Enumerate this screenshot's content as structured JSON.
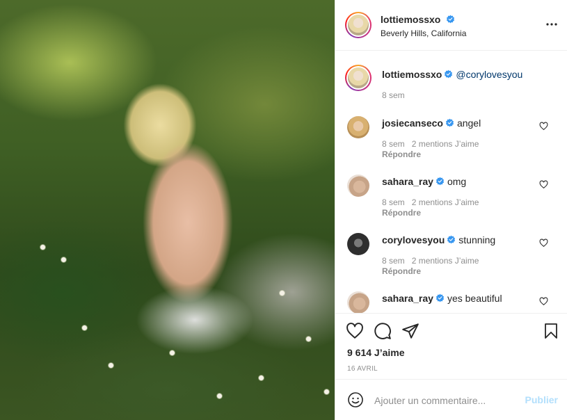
{
  "post": {
    "author": "lottiemossxo",
    "location": "Beverly Hills, California",
    "caption_mention": "@corylovesyou",
    "caption_time": "8 sem",
    "likes": "9 614 J’aime",
    "date": "16 AVRIL"
  },
  "comments": [
    {
      "user": "josiecanseco",
      "text": "angel",
      "time": "8 sem",
      "likes": "2 mentions J’aime",
      "reply": "Répondre"
    },
    {
      "user": "sahara_ray",
      "text": "omg",
      "time": "8 sem",
      "likes": "2 mentions J’aime",
      "reply": "Répondre"
    },
    {
      "user": "corylovesyou",
      "text": "stunning",
      "time": "8 sem",
      "likes": "2 mentions J’aime",
      "reply": "Répondre"
    },
    {
      "user": "sahara_ray",
      "text": "yes beautiful"
    }
  ],
  "add_comment": {
    "placeholder": "Ajouter un commentaire...",
    "publish_label": "Publier"
  },
  "icons": {
    "verified": "verified-badge-icon",
    "more": "more-options-icon",
    "like": "heart-icon",
    "comment": "comment-bubble-icon",
    "share": "paper-plane-icon",
    "save": "bookmark-icon",
    "emoji": "smiley-icon"
  },
  "colors": {
    "verified_blue": "#3897f0",
    "mention_blue": "#00376b",
    "publish_disabled": "#b2dffc",
    "muted_text": "#8e8e8e"
  }
}
